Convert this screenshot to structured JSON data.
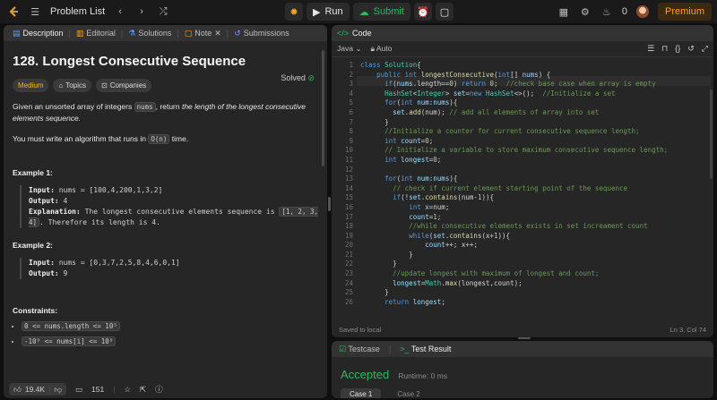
{
  "topbar": {
    "problem_list": "Problem List",
    "run": "Run",
    "submit": "Submit",
    "count": "0",
    "premium": "Premium"
  },
  "left": {
    "tabs": [
      "Description",
      "Editorial",
      "Solutions",
      "Note",
      "Submissions"
    ],
    "title": "128. Longest Consecutive Sequence",
    "solved": "Solved",
    "chips": [
      "Medium",
      "Topics",
      "Companies"
    ],
    "para1_a": "Given an unsorted array of integers ",
    "para1_code": "nums",
    "para1_b": ", return ",
    "para1_em": "the length of the longest consecutive elements sequence.",
    "para2_a": "You must write an algorithm that runs in ",
    "para2_code": "O(n)",
    "para2_b": " time.",
    "example1_h": "Example 1:",
    "ex1_input_label": "Input:",
    "ex1_input": "nums = [100,4,200,1,3,2]",
    "ex1_output_label": "Output:",
    "ex1_output": "4",
    "ex1_expl_label": "Explanation:",
    "ex1_expl_a": "The longest consecutive elements sequence is ",
    "ex1_expl_code": "[1, 2, 3, 4]",
    "ex1_expl_b": ". Therefore its length is 4.",
    "example2_h": "Example 2:",
    "ex2_input_label": "Input:",
    "ex2_input": "nums = [0,3,7,2,5,8,4,6,0,1]",
    "ex2_output_label": "Output:",
    "ex2_output": "9",
    "constraints_h": "Constraints:",
    "constraint1": "0 <= nums.length <= 10⁵",
    "constraint2": "-10⁹ <= nums[i] <= 10⁹",
    "likes": "19.4K",
    "comments": "151"
  },
  "code": {
    "tab": "Code",
    "language": "Java",
    "auto": "Auto",
    "saved": "Saved to local",
    "cursor": "Ln 3, Col 74",
    "line_numbers": [
      "1",
      "2",
      "3",
      "4",
      "5",
      "6",
      "7",
      "8",
      "9",
      "10",
      "11",
      "12",
      "13",
      "14",
      "15",
      "16",
      "17",
      "18",
      "19",
      "20",
      "21",
      "22",
      "23",
      "24",
      "25",
      "26"
    ]
  },
  "bottom": {
    "testcase": "Testcase",
    "test_result": "Test Result",
    "accepted": "Accepted",
    "runtime": "Runtime: 0 ms",
    "case1": "Case 1",
    "case2": "Case 2"
  }
}
